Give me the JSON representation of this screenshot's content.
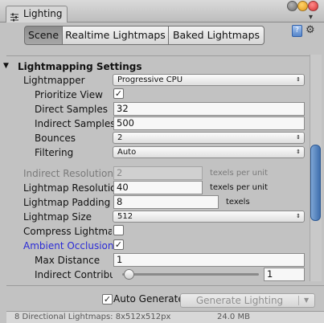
{
  "window": {
    "tab_title": "Lighting",
    "tab_icon": "lighting-window-icon"
  },
  "toolbar": {
    "tabs": [
      "Scene",
      "Realtime Lightmaps",
      "Baked Lightmaps"
    ],
    "selected_tab": "Scene"
  },
  "section": {
    "title": "Lightmapping Settings"
  },
  "settings": {
    "lightmapper": {
      "label": "Lightmapper",
      "value": "Progressive CPU"
    },
    "prioritize_view": {
      "label": "Prioritize View",
      "checked": true
    },
    "direct_samples": {
      "label": "Direct Samples",
      "value": "32"
    },
    "indirect_samples": {
      "label": "Indirect Samples",
      "value": "500"
    },
    "bounces": {
      "label": "Bounces",
      "value": "2"
    },
    "filtering": {
      "label": "Filtering",
      "value": "Auto"
    },
    "indirect_resolution": {
      "label": "Indirect Resolution",
      "value": "2",
      "unit": "texels per unit",
      "disabled": true
    },
    "lightmap_resolution": {
      "label": "Lightmap Resolution",
      "value": "40",
      "unit": "texels per unit"
    },
    "lightmap_padding": {
      "label": "Lightmap Padding",
      "value": "8",
      "unit": "texels"
    },
    "lightmap_size": {
      "label": "Lightmap Size",
      "value": "512"
    },
    "compress_lightmaps": {
      "label": "Compress Lightmaps",
      "checked": false
    },
    "ambient_occlusion": {
      "label": "Ambient Occlusion",
      "checked": true
    },
    "max_distance": {
      "label": "Max Distance",
      "value": "1"
    },
    "indirect_contribution": {
      "label": "Indirect Contribut",
      "value": "1"
    }
  },
  "bottom": {
    "auto_generate": {
      "label": "Auto Generate",
      "checked": true
    },
    "generate_button": "Generate Lighting",
    "info_text": "8 Directional Lightmaps: 8x512x512px",
    "info_size": "24.0 MB"
  },
  "colors": {
    "ambient_occlusion_label": "#2b2bd6",
    "scrollbar_thumb": "#4f7fbf",
    "selected_tab_bg": "#999999"
  }
}
